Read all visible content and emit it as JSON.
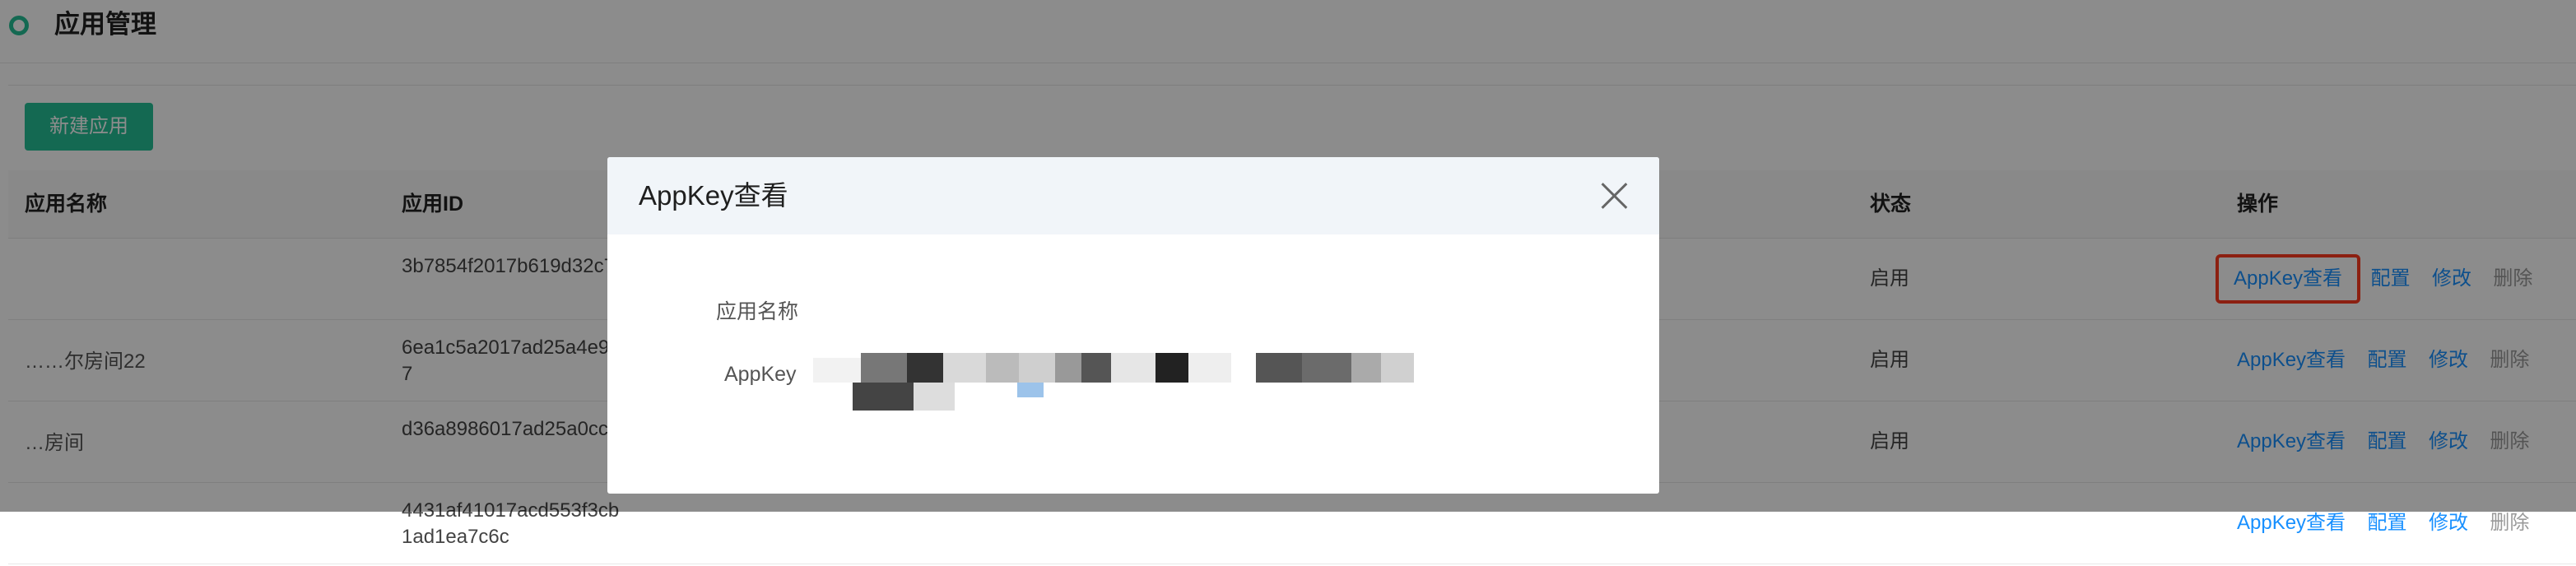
{
  "header": {
    "title": "应用管理"
  },
  "toolbar": {
    "new_app_label": "新建应用"
  },
  "table": {
    "columns": {
      "name": "应用名称",
      "id": "应用ID",
      "status": "状态",
      "actions": "操作"
    },
    "rows": [
      {
        "name": "",
        "id": "3b7854f2017b619d32c7",
        "status": "启用"
      },
      {
        "name": "……尔房间22",
        "id": "6ea1c5a2017ad25a4e9c7",
        "status": "启用"
      },
      {
        "name": "…房间",
        "id": "d36a8986017ad25a0cc7",
        "status": "启用"
      },
      {
        "name": "",
        "id": "4431af41017acd553f3cb1ad1ea7c6c",
        "status": ""
      }
    ],
    "actions": {
      "view_key": "AppKey查看",
      "config": "配置",
      "edit": "修改",
      "delete": "删除"
    }
  },
  "modal": {
    "title": "AppKey查看",
    "app_name_label": "应用名称",
    "appkey_label": "AppKey"
  },
  "colors": {
    "brand": "#26bf95",
    "link": "#1890ff",
    "highlight": "#ff3b1f"
  }
}
